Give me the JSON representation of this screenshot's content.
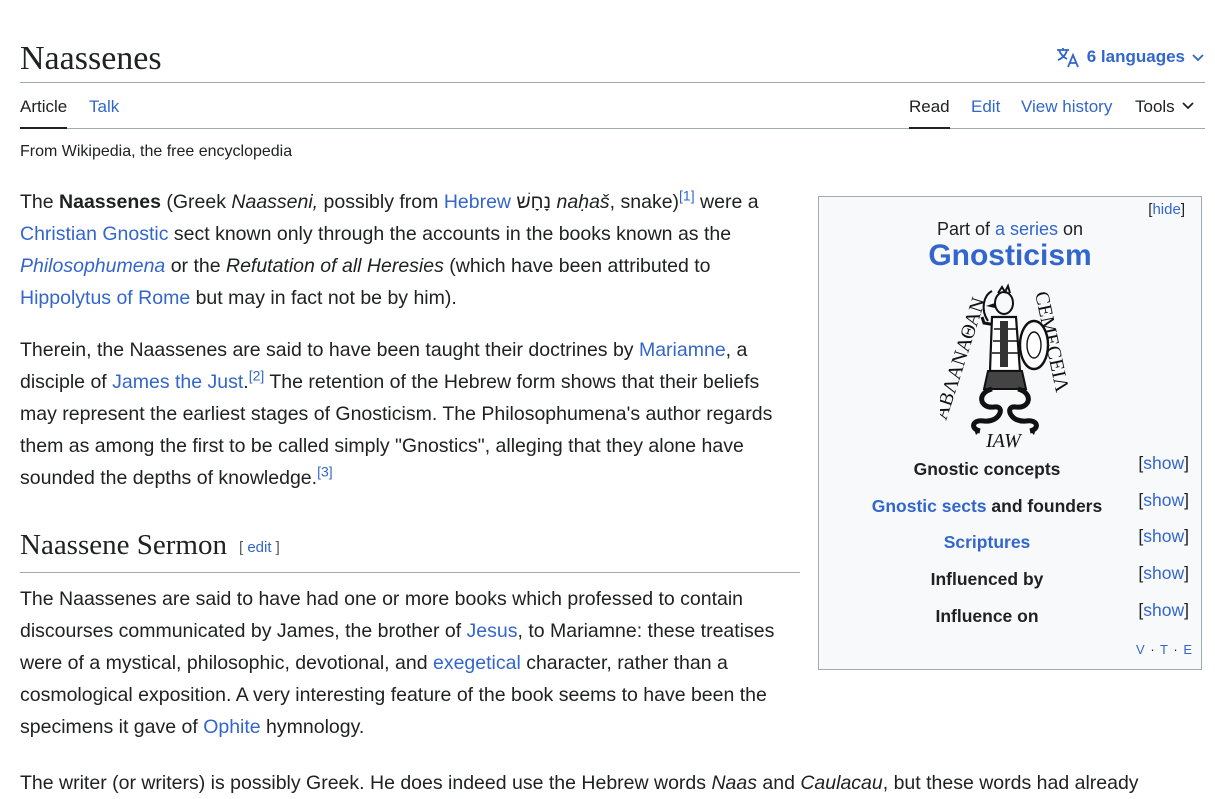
{
  "header": {
    "title": "Naassenes",
    "languages": "6 languages"
  },
  "tabs": {
    "article": "Article",
    "talk": "Talk",
    "read": "Read",
    "edit": "Edit",
    "history": "View history",
    "tools": "Tools"
  },
  "tagline": "From Wikipedia, the free encyclopedia",
  "p1": {
    "t1": "The ",
    "bold": "Naassenes",
    "t2": " (Greek ",
    "it1": "Naasseni,",
    "t3": " possibly from ",
    "link1": "Hebrew",
    "hebrew": " נָחָשׁ ",
    "it2": "naḥaš",
    "t4": ", snake)",
    "ref1": "[1]",
    "t5": " were a ",
    "link2": "Christian Gnostic",
    "t6": " sect known only through the accounts in the books known as the ",
    "link3": "Philosophumena",
    "t7": " or the ",
    "it3": "Refutation of all Heresies",
    "t8": " (which have been attributed to ",
    "link4": "Hippolytus of Rome",
    "t9": " but may in fact not be by him)."
  },
  "p2": {
    "t1": "Therein, the Naassenes are said to have been taught their doctrines by ",
    "link1": "Mariamne",
    "t2": ", a disciple of ",
    "link2": "James the Just",
    "t3": ".",
    "ref2": "[2]",
    "t4": " The retention of the Hebrew form shows that their beliefs may represent the earliest stages of Gnosticism. The Philosophumena's author regards them as among the first to be called simply \"Gnostics\", alleging that they alone have sounded the depths of knowledge.",
    "ref3": "[3]"
  },
  "section": {
    "heading": "Naassene Sermon",
    "edit_open": "[ ",
    "edit": "edit",
    "edit_close": " ]"
  },
  "p3": {
    "t1": "The Naassenes are said to have had one or more books which professed to contain discourses communicated by James, the brother of ",
    "link1": "Jesus",
    "t2": ", to Mariamne: these treatises were of a mystical, philosophic, devotional, and ",
    "link2": "exegetical",
    "t3": " character, rather than a cosmological exposition. A very interesting feature of the book seems to have been the specimens it gave of ",
    "link3": "Ophite",
    "t4": " hymnology."
  },
  "p4": {
    "t1": "The writer (or writers) is possibly Greek. He does indeed use the Hebrew words ",
    "it1": "Naas",
    "t2": " and ",
    "it2": "Caulacau",
    "t3": ", but these words had already"
  },
  "infobox": {
    "hide_open": "[",
    "hide": "hide",
    "hide_close": "]",
    "part_of_1": "Part of ",
    "part_of_link": "a series",
    "part_of_2": " on",
    "title": "Gnosticism",
    "image_inscription_left": "ΑΒΛΑΝΑΘΑΝ",
    "image_inscription_right": "CEMECEIΛ",
    "image_inscription_bottom": "IAW",
    "rows": [
      {
        "label": "Gnostic concepts",
        "link": "",
        "rest": ""
      },
      {
        "label": "",
        "link": "Gnostic sects",
        "rest": " and founders"
      },
      {
        "label": "",
        "link": "Scriptures",
        "rest": ""
      },
      {
        "label": "Influenced by",
        "link": "",
        "rest": ""
      },
      {
        "label": "Influence on",
        "link": "",
        "rest": ""
      }
    ],
    "show_open": "[",
    "show": "show",
    "show_close": "]",
    "vte": [
      "V",
      "T",
      "E"
    ]
  },
  "icons": {
    "language": "translate-icon",
    "chevron": "chevron-down-icon"
  }
}
